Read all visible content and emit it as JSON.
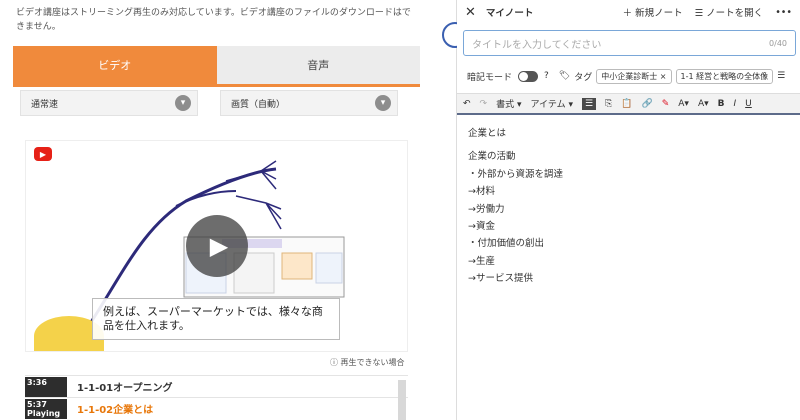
{
  "notice": "ビデオ講座はストリーミング再生のみ対応しています。ビデオ講座のファイルのダウンロードはできません。",
  "tabs": {
    "video": "ビデオ",
    "audio": "音声"
  },
  "selects": {
    "speed": "通常速",
    "quality": "画質（自動）"
  },
  "player": {
    "logo": "▶",
    "play": "▶",
    "caption": "例えば、スーパーマーケットでは、様々な商品を仕入れます。"
  },
  "replay_text": "再生できない場合",
  "videos": [
    {
      "thumb_time": "3:36",
      "thumb_label": "",
      "title": "1-1-01オープニング"
    },
    {
      "thumb_time": "5:37",
      "thumb_label": "Playing",
      "title": "1-1-02企業とは"
    }
  ],
  "note": {
    "title": "マイノート",
    "new_note": "新規ノート",
    "open_note": "ノートを開く",
    "more": "•••",
    "title_placeholder": "タイトルを入力してください",
    "char_count": "0/40",
    "memorize_mode": "暗記モード",
    "tag_label": "タグ",
    "tags": [
      "中小企業診断士",
      "1-1 経営と戦略の全体像"
    ],
    "toolbar": {
      "format": "書式",
      "item": "アイテム"
    },
    "lines": [
      "企業とは",
      "企業の活動",
      "・外部から資源を調達",
      "→材料",
      "→労働力",
      "→資金",
      "・付加価値の創出",
      "→生産",
      "→サービス提供"
    ]
  }
}
